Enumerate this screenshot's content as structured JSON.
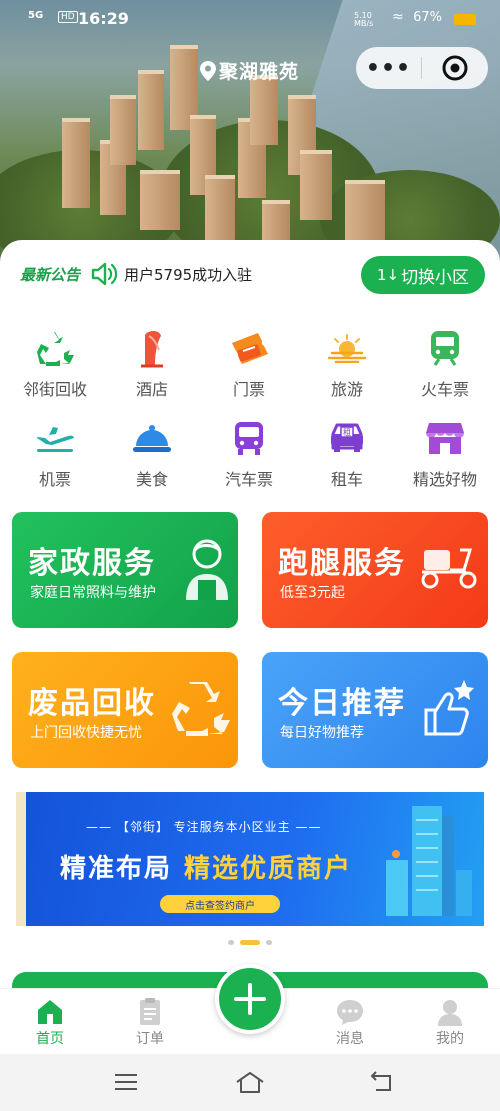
{
  "status_bar": {
    "network": "5G",
    "hd": "HD",
    "time": "16:29",
    "speed": "5.10 MB/s",
    "battery": "67%"
  },
  "header": {
    "location": "聚湖雅苑"
  },
  "notice": {
    "title": "最新公告",
    "text": "用户5795成功入驻",
    "switch_label": "切换小区",
    "switch_prefix": "1↓"
  },
  "services": [
    {
      "label": "邻街回收",
      "icon": "recycle-icon"
    },
    {
      "label": "酒店",
      "icon": "hotel-icon"
    },
    {
      "label": "门票",
      "icon": "ticket-icon"
    },
    {
      "label": "旅游",
      "icon": "travel-icon"
    },
    {
      "label": "火车票",
      "icon": "train-icon"
    },
    {
      "label": "机票",
      "icon": "plane-icon"
    },
    {
      "label": "美食",
      "icon": "food-icon"
    },
    {
      "label": "汽车票",
      "icon": "bus-icon"
    },
    {
      "label": "租车",
      "icon": "car-rental-icon"
    },
    {
      "label": "精选好物",
      "icon": "shop-icon"
    }
  ],
  "cards": [
    {
      "title": "家政服务",
      "subtitle": "家庭日常照料与维护",
      "color": "#1bb150"
    },
    {
      "title": "跑腿服务",
      "subtitle": "低至3元起",
      "color": "#fa4a1f"
    },
    {
      "title": "废品回收",
      "subtitle": "上门回收快捷无忧",
      "color": "#fb9e0a"
    },
    {
      "title": "今日推荐",
      "subtitle": "每日好物推荐",
      "color": "#3a8ff3"
    }
  ],
  "banner": {
    "subtitle": "—— 【邻街】 专注服务本小区业主 ——",
    "headline_white": "精准布局",
    "headline_yellow": "精选优质商户",
    "cta": "点击查签约商户"
  },
  "tabs": [
    {
      "label": "首页",
      "active": true
    },
    {
      "label": "订单",
      "active": false
    },
    {
      "label": "消息",
      "active": false
    },
    {
      "label": "我的",
      "active": false
    }
  ],
  "colors": {
    "brand": "#1bb150"
  }
}
